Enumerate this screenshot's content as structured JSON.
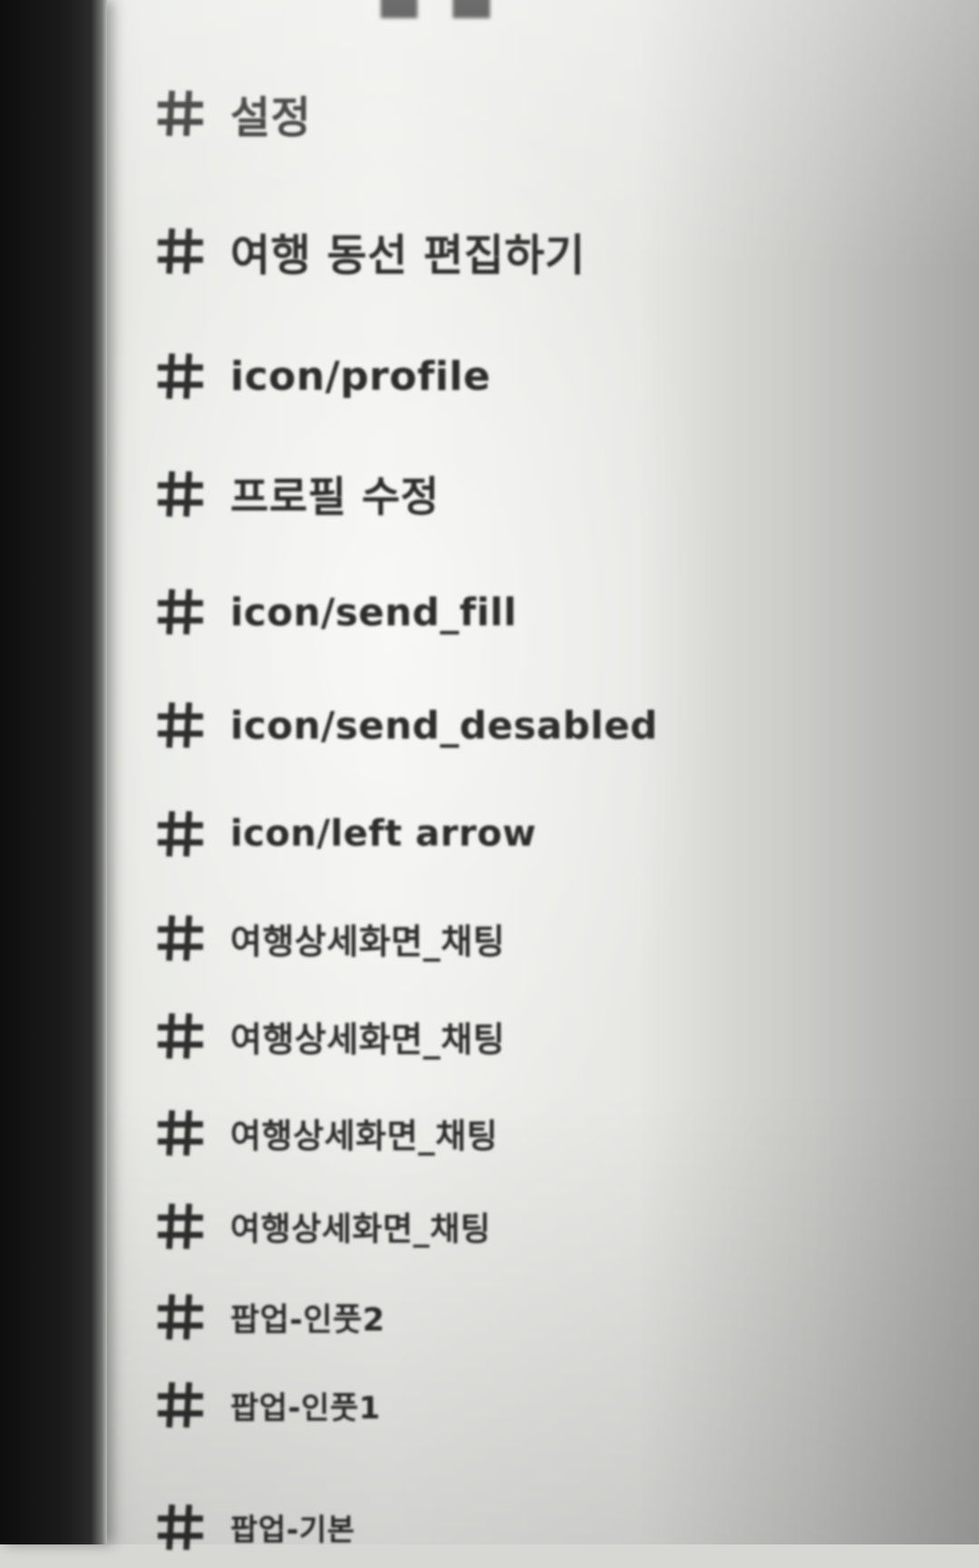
{
  "layers_panel": {
    "items": [
      {
        "icon": "frame-icon",
        "label": "설정"
      },
      {
        "icon": "frame-icon",
        "label": "여행 동선 편집하기"
      },
      {
        "icon": "frame-icon",
        "label": "icon/profile"
      },
      {
        "icon": "frame-icon",
        "label": "프로필 수정"
      },
      {
        "icon": "frame-icon",
        "label": "icon/send_fill"
      },
      {
        "icon": "frame-icon",
        "label": "icon/send_desabled"
      },
      {
        "icon": "frame-icon",
        "label": "icon/left arrow"
      },
      {
        "icon": "frame-icon",
        "label": "여행상세화면_채팅"
      },
      {
        "icon": "frame-icon",
        "label": "여행상세화면_채팅"
      },
      {
        "icon": "frame-icon",
        "label": "여행상세화면_채팅"
      },
      {
        "icon": "frame-icon",
        "label": "여행상세화면_채팅"
      },
      {
        "icon": "frame-icon",
        "label": "팝업-인풋2"
      },
      {
        "icon": "frame-icon",
        "label": "팝업-인풋1"
      },
      {
        "icon": "frame-icon",
        "label": "팝업-기본"
      }
    ]
  },
  "colors": {
    "text": "#2c2d2c",
    "bezel": "#111211",
    "screen": "#ececea"
  }
}
